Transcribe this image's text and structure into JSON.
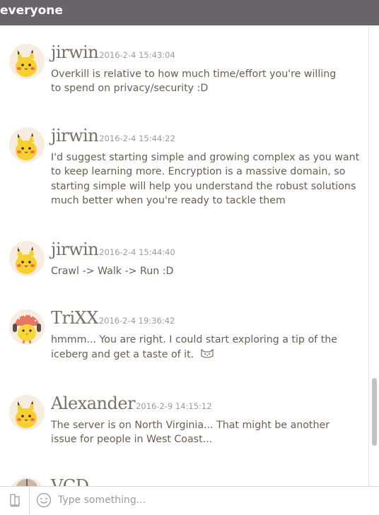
{
  "header": {
    "title": "everyone"
  },
  "messages": [
    {
      "user": "jirwin",
      "time": "2016-2-4 15:43:04",
      "avatar": "pikachu-avatar",
      "text": [
        "Overkill is relative to how much time/effort you're willing",
        "to spend on privacy/security :D"
      ]
    },
    {
      "user": "jirwin",
      "time": "2016-2-4 15:44:22",
      "avatar": "pikachu-avatar",
      "text": [
        "I'd suggest starting simple and growing complex as you want",
        "to keep learning more. Encryption is a massive domain, so",
        "starting simple will help you understand the robust solutions",
        "much better when you're ready to tackle them"
      ]
    },
    {
      "user": "jirwin",
      "time": "2016-2-4 15:44:40",
      "avatar": "pikachu-avatar",
      "text": [
        "Crawl -> Walk -> Run :D"
      ]
    },
    {
      "user": "TriXX",
      "time": "2016-2-4 19:36:42",
      "avatar": "chick-headphones-avatar",
      "text": [
        "hmmm... You are right. I could start exploring a tip of the",
        "iceberg and get a taste of it."
      ],
      "sticker": "cat-face-icon"
    },
    {
      "user": "Alexander",
      "time": "2016-2-9 14:15:12",
      "avatar": "pikachu-avatar",
      "text": [
        "The server is on North Virginia... That might be another",
        "issue for people in West Coast..."
      ]
    },
    {
      "user": "VCD",
      "time": "",
      "avatar": "parasol-avatar",
      "text": []
    }
  ],
  "composer": {
    "placeholder": "Type something..."
  },
  "icons": {
    "attach": "attach-icon",
    "emoji": "smiley-icon"
  },
  "colors": {
    "header_bg": "#6a636a",
    "username": "#7b6f63",
    "message_text": "#6b5d4f",
    "timestamp": "#9b9b9b",
    "avatar_yellow": "#f7cf2f"
  }
}
